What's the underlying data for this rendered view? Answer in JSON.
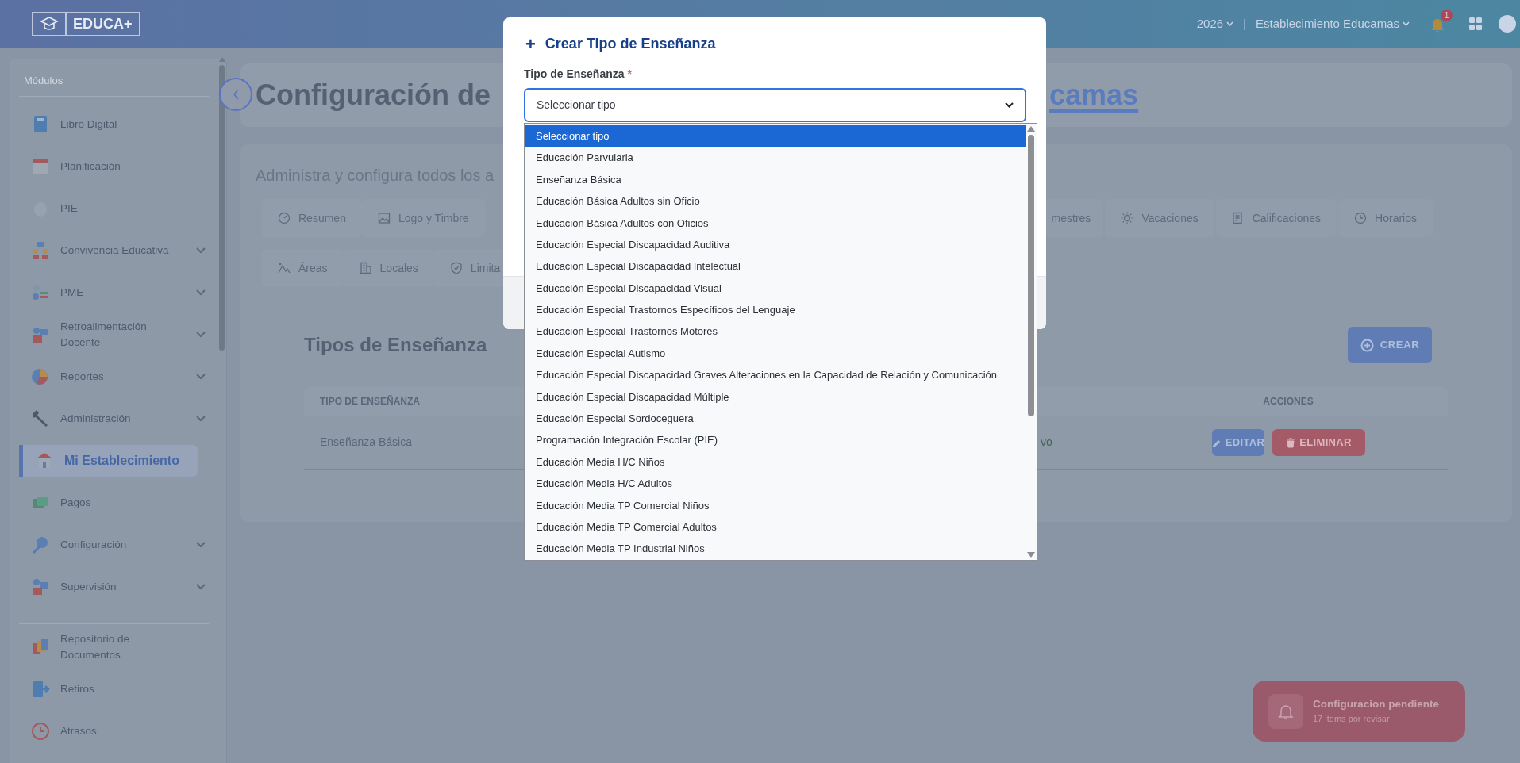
{
  "header": {
    "logo": "EDUCA+",
    "year": "2026",
    "separator": "|",
    "school": "Establecimiento Educamas",
    "notification_count": "1"
  },
  "sidebar": {
    "section_label": "Módulos",
    "items": [
      {
        "label": "Libro Digital",
        "expandable": false,
        "selected": false
      },
      {
        "label": "Planificación",
        "expandable": false,
        "selected": false
      },
      {
        "label": "PIE",
        "expandable": false,
        "selected": false
      },
      {
        "label": "Convivencia Educativa",
        "expandable": true,
        "selected": false
      },
      {
        "label": "PME",
        "expandable": true,
        "selected": false
      },
      {
        "label": "Retroalimentación Docente",
        "expandable": true,
        "selected": false
      },
      {
        "label": "Reportes",
        "expandable": true,
        "selected": false
      },
      {
        "label": "Administración",
        "expandable": true,
        "selected": false
      },
      {
        "label": "Mi Establecimiento",
        "expandable": false,
        "selected": true
      },
      {
        "label": "Pagos",
        "expandable": false,
        "selected": false
      },
      {
        "label": "Configuración",
        "expandable": true,
        "selected": false
      },
      {
        "label": "Supervisión",
        "expandable": true,
        "selected": false
      }
    ],
    "bottom_items": [
      {
        "label": "Repositorio de Documentos",
        "expandable": false,
        "selected": false
      },
      {
        "label": "Retiros",
        "expandable": false,
        "selected": false
      },
      {
        "label": "Atrasos",
        "expandable": false,
        "selected": false
      }
    ]
  },
  "page_header": {
    "title": "Configuración de",
    "link": "camas"
  },
  "config": {
    "description": "Administra y configura todos los a",
    "tab_rows": [
      {
        "left": [
          {
            "label": "Resumen"
          },
          {
            "label": "Logo y Timbre"
          }
        ],
        "right": [
          {
            "label": "mestres"
          },
          {
            "label": "Vacaciones"
          },
          {
            "label": "Calificaciones"
          },
          {
            "label": "Horarios"
          }
        ]
      },
      {
        "left": [
          {
            "label": "Áreas"
          },
          {
            "label": "Locales"
          },
          {
            "label": "Limita"
          }
        ],
        "right": []
      }
    ]
  },
  "section": {
    "title": "Tipos de Enseñanza",
    "create_button": "CREAR",
    "table": {
      "columns": [
        "TIPO DE ENSEÑANZA",
        "ACCIONES"
      ],
      "rows": [
        {
          "tipo": "Enseñanza Básica",
          "column_2": "vo",
          "actions": [
            "EDITAR",
            "ELIMINAR"
          ]
        }
      ]
    }
  },
  "modal": {
    "title_icon": "+",
    "title": "Crear Tipo de Enseñanza",
    "field_label": "Tipo de Enseñanza",
    "required_mark": "*",
    "select_value": "Seleccionar tipo",
    "options": [
      {
        "label": "Seleccionar tipo",
        "selected": true
      },
      {
        "label": "Educación Parvularia",
        "selected": false
      },
      {
        "label": "Enseñanza Básica",
        "selected": false
      },
      {
        "label": "Educación Básica Adultos sin Oficio",
        "selected": false
      },
      {
        "label": "Educación Básica Adultos con Oficios",
        "selected": false
      },
      {
        "label": "Educación Especial Discapacidad Auditiva",
        "selected": false
      },
      {
        "label": "Educación Especial Discapacidad Intelectual",
        "selected": false
      },
      {
        "label": "Educación Especial Discapacidad Visual",
        "selected": false
      },
      {
        "label": "Educación Especial Trastornos Específicos del Lenguaje",
        "selected": false
      },
      {
        "label": "Educación Especial Trastornos Motores",
        "selected": false
      },
      {
        "label": "Educación Especial Autismo",
        "selected": false
      },
      {
        "label": "Educación Especial Discapacidad Graves Alteraciones en la Capacidad de Relación y Comunicación",
        "selected": false
      },
      {
        "label": "Educación Especial Discapacidad Múltiple",
        "selected": false
      },
      {
        "label": "Educación Especial Sordoceguera",
        "selected": false
      },
      {
        "label": "Programación Integración Escolar (PIE)",
        "selected": false
      },
      {
        "label": "Educación Media H/C Niños",
        "selected": false
      },
      {
        "label": "Educación Media H/C Adultos",
        "selected": false
      },
      {
        "label": "Educación Media TP Comercial Niños",
        "selected": false
      },
      {
        "label": "Educación Media TP Comercial Adultos",
        "selected": false
      },
      {
        "label": "Educación Media TP Industrial Niños",
        "selected": false
      }
    ]
  },
  "toast": {
    "title": "Configuracion pendiente",
    "subtitle": "17 items por revisar"
  }
}
